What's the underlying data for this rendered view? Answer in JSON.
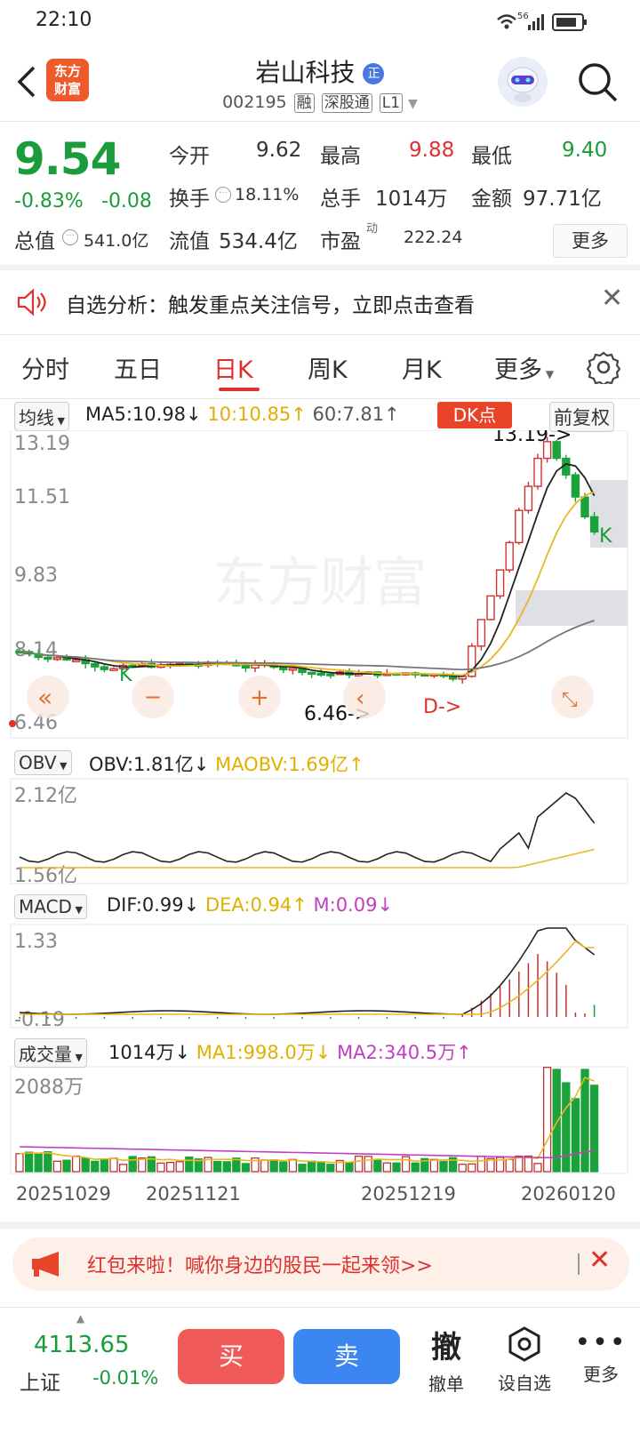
{
  "status_bar": {
    "time": "22:10",
    "network": "56",
    "icons": [
      "wifi-icon",
      "signal-icon",
      "battery-icon"
    ]
  },
  "header": {
    "title": "岩山科技",
    "title_badge": "正",
    "code": "002195",
    "tags": [
      "融",
      "深股通",
      "L1"
    ],
    "logo_text_1": "东方",
    "logo_text_2": "财富"
  },
  "quote": {
    "price": "9.54",
    "change_pct": "-0.83%",
    "change": "-0.08",
    "open_label": "今开",
    "open": "9.62",
    "high_label": "最高",
    "high": "9.88",
    "low_label": "最低",
    "low": "9.40",
    "turnover_label": "换手",
    "turnover": "18.11%",
    "volume_label": "总手",
    "volume": "1014万",
    "amount_label": "金额",
    "amount": "97.71亿",
    "mktcap_label": "总值",
    "mktcap": "541.0亿",
    "float_label": "流值",
    "float": "534.4亿",
    "pe_label": "市盈",
    "pe_sup": "动",
    "pe": "222.24",
    "more_label": "更多"
  },
  "notice": {
    "text": "自选分析：触发重点关注信号，立即点击查看"
  },
  "tabs": [
    "分时",
    "五日",
    "日K",
    "周K",
    "月K",
    "更多"
  ],
  "active_tab": 2,
  "kline": {
    "ma_selector": "均线",
    "ma5": "MA5:10.98↓",
    "ma10": "10:10.85↑",
    "ma60": "60:7.81↑",
    "dk_label": "DK点",
    "adjust_label": "前复权",
    "y_labels": [
      "13.19",
      "11.51",
      "9.83",
      "8.14",
      "6.46"
    ],
    "max_label": "13.19->",
    "min_label": "6.46->",
    "k_mark": "K",
    "d_mark": "D->",
    "watermark": "东方财富",
    "colors": {
      "up": "#d0302e",
      "down": "#1aa33a",
      "ma5": "#222222",
      "ma10": "#e8b820",
      "ma60": "#777777"
    }
  },
  "obv": {
    "selector": "OBV",
    "value": "OBV:1.81亿↓",
    "ma": "MAOBV:1.69亿↑",
    "y_top": "2.12亿",
    "y_bot": "1.56亿"
  },
  "macd": {
    "selector": "MACD",
    "dif": "DIF:0.99↓",
    "dea": "DEA:0.94↑",
    "m": "M:0.09↓",
    "y_top": "1.33",
    "y_bot": "-0.19"
  },
  "volume_panel": {
    "selector": "成交量",
    "value": "1014万↓",
    "ma1": "MA1:998.0万↓",
    "ma2": "MA2:340.5万↑",
    "y_top": "2088万"
  },
  "dates": [
    "20251029",
    "20251121",
    "20251219",
    "20260120"
  ],
  "promo": {
    "text": "红包来啦！喊你身边的股民一起来领>>"
  },
  "footer": {
    "index_value": "4113.65",
    "index_name": "上证",
    "index_change": "-0.01%",
    "buy": "买",
    "sell": "卖",
    "revoke_char": "撤",
    "revoke_label": "撤单",
    "watch_label": "设自选",
    "more_label": "更多"
  }
}
